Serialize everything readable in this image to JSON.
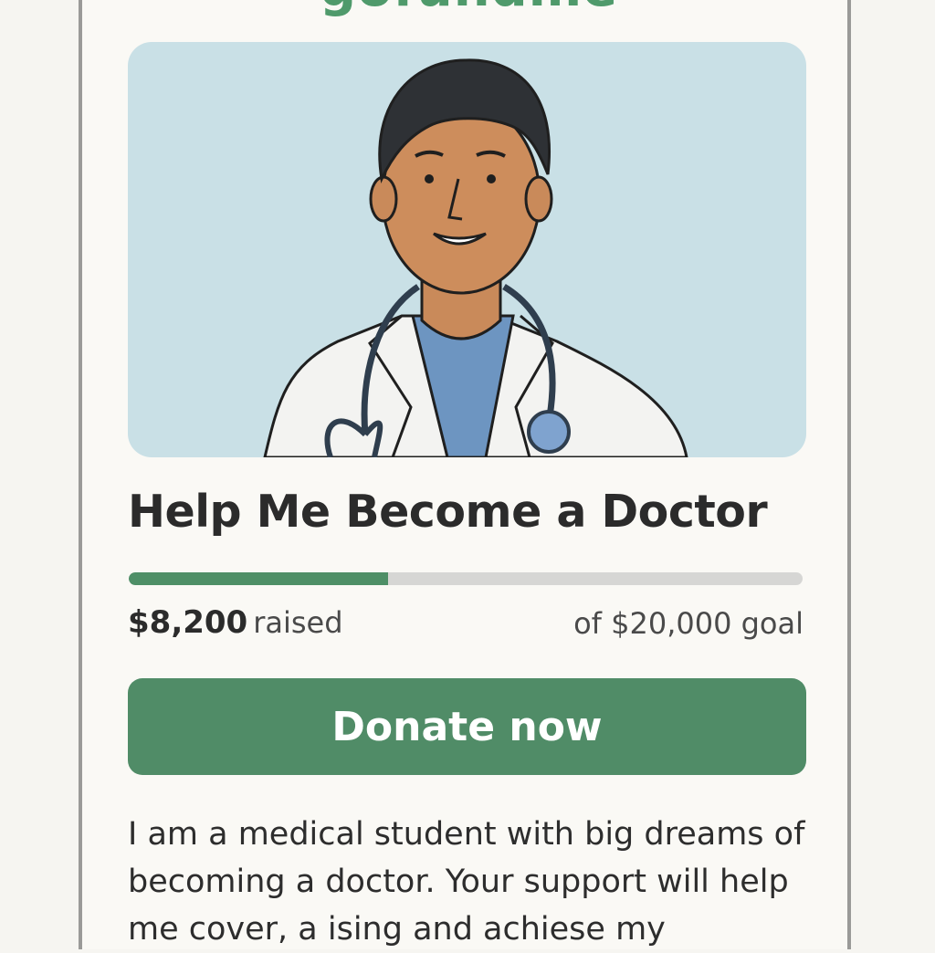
{
  "brand": {
    "logo_text": "gofundme",
    "color": "#4f9a6b"
  },
  "campaign": {
    "image_alt": "illustration of a doctor wearing a white coat and stethoscope",
    "title": "Help Me Become a Doctor",
    "raised": "$8,200",
    "raised_label": "raised",
    "goal_text": "of $20,000 goal",
    "progress_fraction": 0.385,
    "donate_label": "Donate now",
    "story": "I am a medical student with big dreams of becoming a doctor. Your support will help me cover, a ising and achiese my"
  },
  "colors": {
    "accent": "#4e8f67",
    "track": "#d6d6d4",
    "hero_bg": "#c9e0e6"
  }
}
